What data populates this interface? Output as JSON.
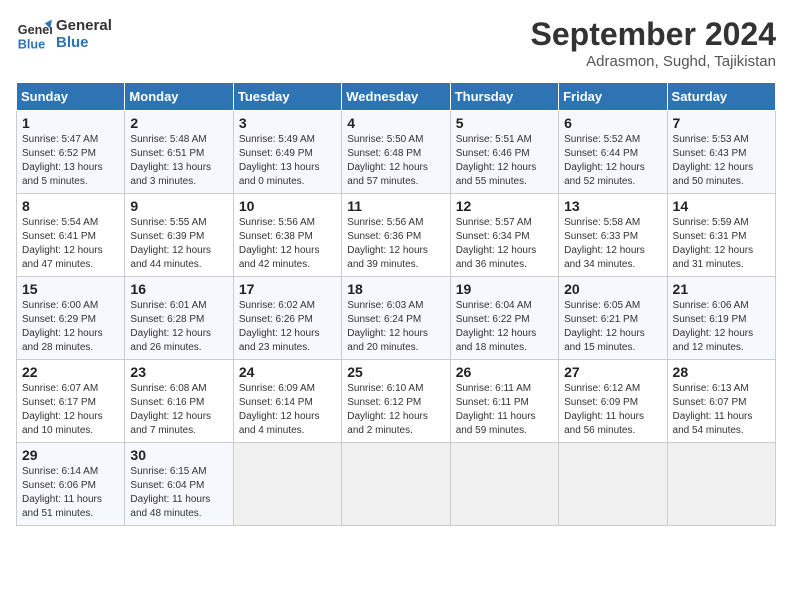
{
  "header": {
    "logo_line1": "General",
    "logo_line2": "Blue",
    "month": "September 2024",
    "location": "Adrasmon, Sughd, Tajikistan"
  },
  "days_of_week": [
    "Sunday",
    "Monday",
    "Tuesday",
    "Wednesday",
    "Thursday",
    "Friday",
    "Saturday"
  ],
  "weeks": [
    [
      {
        "day": "1",
        "info": "Sunrise: 5:47 AM\nSunset: 6:52 PM\nDaylight: 13 hours\nand 5 minutes."
      },
      {
        "day": "2",
        "info": "Sunrise: 5:48 AM\nSunset: 6:51 PM\nDaylight: 13 hours\nand 3 minutes."
      },
      {
        "day": "3",
        "info": "Sunrise: 5:49 AM\nSunset: 6:49 PM\nDaylight: 13 hours\nand 0 minutes."
      },
      {
        "day": "4",
        "info": "Sunrise: 5:50 AM\nSunset: 6:48 PM\nDaylight: 12 hours\nand 57 minutes."
      },
      {
        "day": "5",
        "info": "Sunrise: 5:51 AM\nSunset: 6:46 PM\nDaylight: 12 hours\nand 55 minutes."
      },
      {
        "day": "6",
        "info": "Sunrise: 5:52 AM\nSunset: 6:44 PM\nDaylight: 12 hours\nand 52 minutes."
      },
      {
        "day": "7",
        "info": "Sunrise: 5:53 AM\nSunset: 6:43 PM\nDaylight: 12 hours\nand 50 minutes."
      }
    ],
    [
      {
        "day": "8",
        "info": "Sunrise: 5:54 AM\nSunset: 6:41 PM\nDaylight: 12 hours\nand 47 minutes."
      },
      {
        "day": "9",
        "info": "Sunrise: 5:55 AM\nSunset: 6:39 PM\nDaylight: 12 hours\nand 44 minutes."
      },
      {
        "day": "10",
        "info": "Sunrise: 5:56 AM\nSunset: 6:38 PM\nDaylight: 12 hours\nand 42 minutes."
      },
      {
        "day": "11",
        "info": "Sunrise: 5:56 AM\nSunset: 6:36 PM\nDaylight: 12 hours\nand 39 minutes."
      },
      {
        "day": "12",
        "info": "Sunrise: 5:57 AM\nSunset: 6:34 PM\nDaylight: 12 hours\nand 36 minutes."
      },
      {
        "day": "13",
        "info": "Sunrise: 5:58 AM\nSunset: 6:33 PM\nDaylight: 12 hours\nand 34 minutes."
      },
      {
        "day": "14",
        "info": "Sunrise: 5:59 AM\nSunset: 6:31 PM\nDaylight: 12 hours\nand 31 minutes."
      }
    ],
    [
      {
        "day": "15",
        "info": "Sunrise: 6:00 AM\nSunset: 6:29 PM\nDaylight: 12 hours\nand 28 minutes."
      },
      {
        "day": "16",
        "info": "Sunrise: 6:01 AM\nSunset: 6:28 PM\nDaylight: 12 hours\nand 26 minutes."
      },
      {
        "day": "17",
        "info": "Sunrise: 6:02 AM\nSunset: 6:26 PM\nDaylight: 12 hours\nand 23 minutes."
      },
      {
        "day": "18",
        "info": "Sunrise: 6:03 AM\nSunset: 6:24 PM\nDaylight: 12 hours\nand 20 minutes."
      },
      {
        "day": "19",
        "info": "Sunrise: 6:04 AM\nSunset: 6:22 PM\nDaylight: 12 hours\nand 18 minutes."
      },
      {
        "day": "20",
        "info": "Sunrise: 6:05 AM\nSunset: 6:21 PM\nDaylight: 12 hours\nand 15 minutes."
      },
      {
        "day": "21",
        "info": "Sunrise: 6:06 AM\nSunset: 6:19 PM\nDaylight: 12 hours\nand 12 minutes."
      }
    ],
    [
      {
        "day": "22",
        "info": "Sunrise: 6:07 AM\nSunset: 6:17 PM\nDaylight: 12 hours\nand 10 minutes."
      },
      {
        "day": "23",
        "info": "Sunrise: 6:08 AM\nSunset: 6:16 PM\nDaylight: 12 hours\nand 7 minutes."
      },
      {
        "day": "24",
        "info": "Sunrise: 6:09 AM\nSunset: 6:14 PM\nDaylight: 12 hours\nand 4 minutes."
      },
      {
        "day": "25",
        "info": "Sunrise: 6:10 AM\nSunset: 6:12 PM\nDaylight: 12 hours\nand 2 minutes."
      },
      {
        "day": "26",
        "info": "Sunrise: 6:11 AM\nSunset: 6:11 PM\nDaylight: 11 hours\nand 59 minutes."
      },
      {
        "day": "27",
        "info": "Sunrise: 6:12 AM\nSunset: 6:09 PM\nDaylight: 11 hours\nand 56 minutes."
      },
      {
        "day": "28",
        "info": "Sunrise: 6:13 AM\nSunset: 6:07 PM\nDaylight: 11 hours\nand 54 minutes."
      }
    ],
    [
      {
        "day": "29",
        "info": "Sunrise: 6:14 AM\nSunset: 6:06 PM\nDaylight: 11 hours\nand 51 minutes."
      },
      {
        "day": "30",
        "info": "Sunrise: 6:15 AM\nSunset: 6:04 PM\nDaylight: 11 hours\nand 48 minutes."
      },
      {
        "day": "",
        "info": ""
      },
      {
        "day": "",
        "info": ""
      },
      {
        "day": "",
        "info": ""
      },
      {
        "day": "",
        "info": ""
      },
      {
        "day": "",
        "info": ""
      }
    ]
  ]
}
